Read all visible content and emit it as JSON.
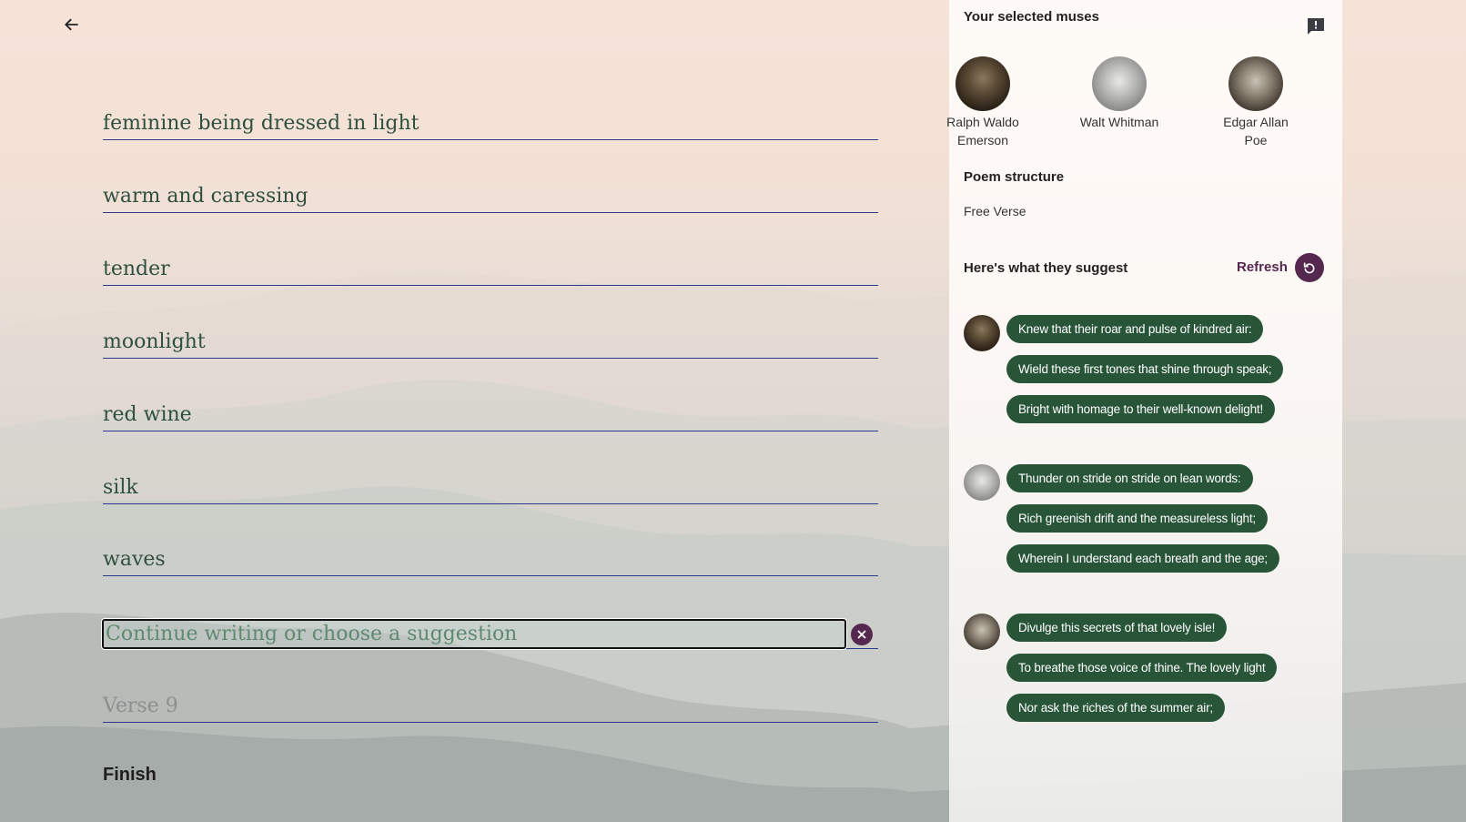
{
  "nav": {
    "back_icon": "arrow-left-icon"
  },
  "poem": {
    "verses": [
      "feminine being dressed in light",
      "warm and caressing",
      "tender",
      "moonlight",
      "red wine",
      "silk",
      "waves"
    ],
    "active_input": {
      "value": "",
      "placeholder": "Continue writing or choose a suggestion"
    },
    "next_verse_placeholder": "Verse 9",
    "finish_label": "Finish"
  },
  "sidebar": {
    "muses_title": "Your selected muses",
    "feedback_icon": "feedback-icon",
    "muses": [
      {
        "name_line1": "Ralph Waldo",
        "name_line2": "Emerson"
      },
      {
        "name_line1": "Walt Whitman",
        "name_line2": ""
      },
      {
        "name_line1": "Edgar Allan",
        "name_line2": "Poe"
      }
    ],
    "structure_title": "Poem structure",
    "structure_value": "Free Verse",
    "suggest_title": "Here's what they suggest",
    "refresh_label": "Refresh",
    "suggestion_groups": [
      {
        "muse": "Ralph Waldo Emerson",
        "lines": [
          "Knew that their roar and pulse of kindred air:",
          "Wield these first tones that shine through speak;",
          "Bright with homage to their well-known delight!"
        ]
      },
      {
        "muse": "Walt Whitman",
        "lines": [
          "Thunder on stride on stride on lean words:",
          "Rich greenish drift and the measureless light;",
          "Wherein I understand each breath and the age;"
        ]
      },
      {
        "muse": "Edgar Allan Poe",
        "lines": [
          "Divulge this secrets of that lovely isle!",
          "To breathe those voice of thine. The lovely light",
          "Nor ask the riches of the summer air;"
        ]
      }
    ]
  },
  "colors": {
    "accent": "#55284f",
    "chip": "#285538",
    "verse_text": "#2f4f3f",
    "underline": "#2a3a8f"
  }
}
